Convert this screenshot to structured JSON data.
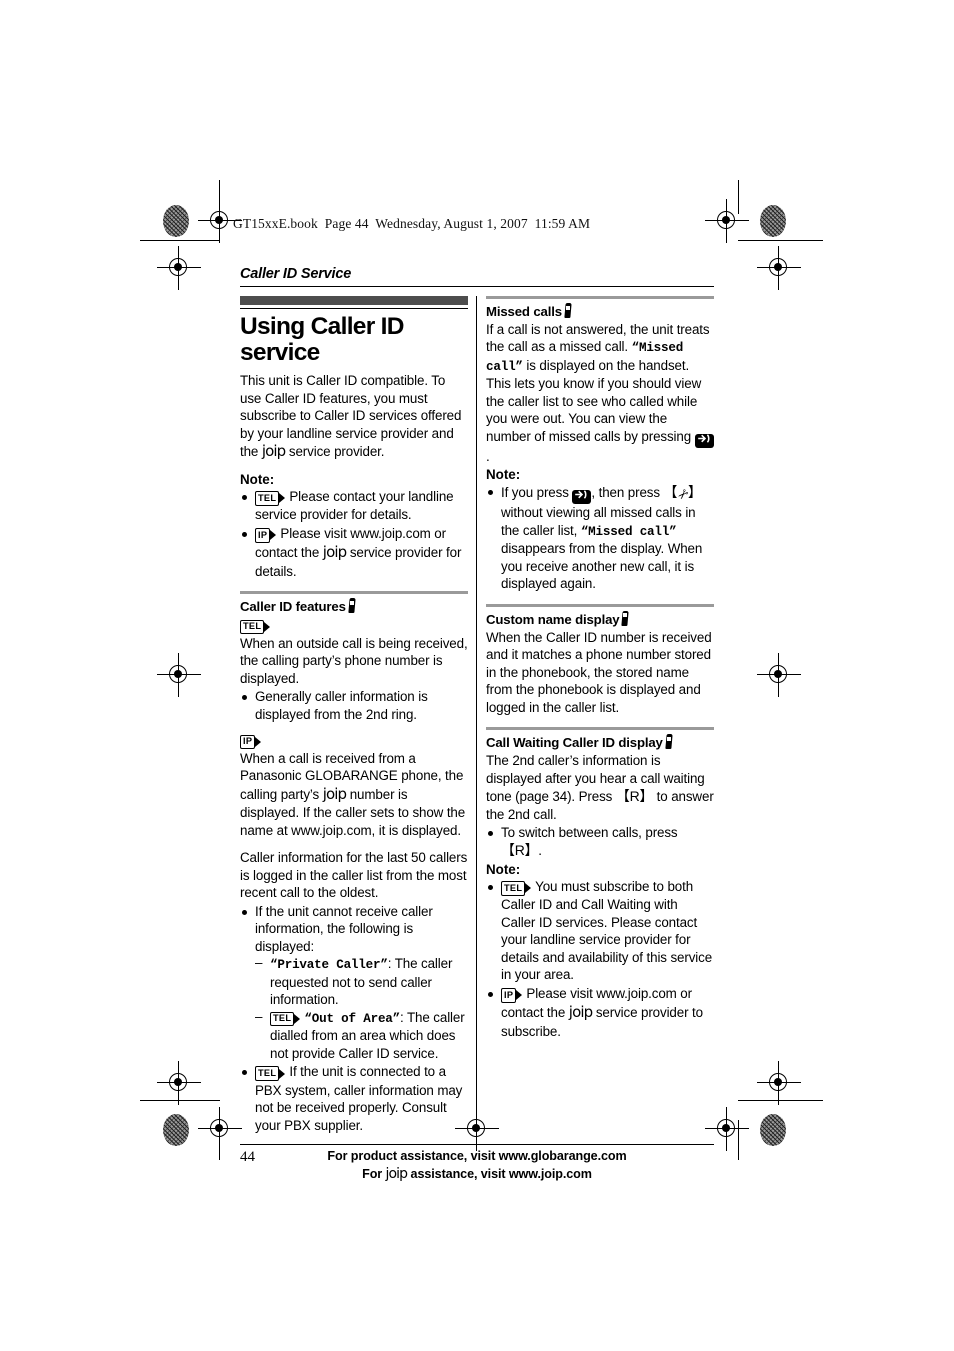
{
  "file_banner": "GT15xxE.book  Page 44  Wednesday, August 1, 2007  11:59 AM",
  "running_head": "Caller ID Service",
  "left_column": {
    "title": "Using Caller ID service",
    "intro_1": "This unit is Caller ID compatible. To use Caller ID features, you must subscribe to Caller ID services offered by your landline service provider and the ",
    "intro_joip": "joip",
    "intro_2": " service provider.",
    "note_label": "Note:",
    "note_items": [
      {
        "badge": "TEL",
        "text": "Please contact your landline service provider for details."
      },
      {
        "badge": "IP",
        "text_before": "Please visit www.joip.com or contact the ",
        "joip": "joip",
        "text_after": " service provider for details."
      }
    ],
    "features_heading": "Caller ID features",
    "tel_badge": "TEL",
    "tel_text": "When an outside call is being received, the calling party’s phone number is displayed.",
    "tel_bullet": "Generally caller information is displayed from the 2nd ring.",
    "ip_badge": "IP",
    "ip_text_1": "When a call is received from a Panasonic GLOBARANGE phone, the calling party’s ",
    "ip_joip": "joip",
    "ip_text_2": " number is displayed. If the caller sets to show the name at www.joip.com, it is displayed.",
    "log_text": "Caller information for the last 50 callers is logged in the caller list from the most recent call to the oldest.",
    "cannot_receive": "If the unit cannot receive caller information, the following is displayed:",
    "private_caller_mono": "“Private Caller”",
    "private_caller_rest": ": The caller requested not to send caller information.",
    "out_of_area_badge": "TEL",
    "out_of_area_mono": "“Out of Area”",
    "out_of_area_rest": ": The caller dialled from an area which does not provide Caller ID service.",
    "pbx_badge": "TEL",
    "pbx_text": "If the unit is connected to a PBX system, caller information may not be received properly. Consult your PBX supplier."
  },
  "right_column": {
    "missed_heading": "Missed calls",
    "missed_text_1": "If a call is not answered, the unit treats the call as a missed call. ",
    "missed_mono_1": "“Missed call”",
    "missed_text_2": " is displayed on the handset. This lets you know if you should view the caller list to see who called while you were out. You can view the number of missed calls by pressing ",
    "missed_text_3": ".",
    "note_label": "Note:",
    "note_text_1": "If you press ",
    "note_text_2": ", then press ",
    "note_text_3": " without viewing all missed calls in the caller list, ",
    "note_mono": "“Missed call”",
    "note_text_4": " disappears from the display. When you receive another new call, it is displayed again.",
    "custom_heading": "Custom name display",
    "custom_text": "When the Caller ID number is received and it matches a phone number stored in the phonebook, the stored name from the phonebook is displayed and logged in the caller list.",
    "cw_heading": "Call Waiting Caller ID display",
    "cw_text_1": "The 2nd caller’s information is displayed after you hear a call waiting tone (page 34). Press ",
    "cw_key": "R",
    "cw_text_2": " to answer the 2nd call.",
    "cw_bullet_1": "To switch between calls, press ",
    "cw_bullet_2": ".",
    "cw_note_label": "Note:",
    "cw_note_1_badge": "TEL",
    "cw_note_1_text": "You must subscribe to both Caller ID and Call Waiting with Caller ID services. Please contact your landline service provider for details and availability of this service in your area.",
    "cw_note_2_badge": "IP",
    "cw_note_2_before": "Please visit www.joip.com or contact the ",
    "cw_note_2_joip": "joip",
    "cw_note_2_after": " service provider to subscribe."
  },
  "footer": {
    "page_number": "44",
    "line1": "For product assistance, visit www.globarange.com",
    "line2_before": "For ",
    "line2_joip": "joip",
    "line2_after": " assistance, visit www.joip.com"
  }
}
